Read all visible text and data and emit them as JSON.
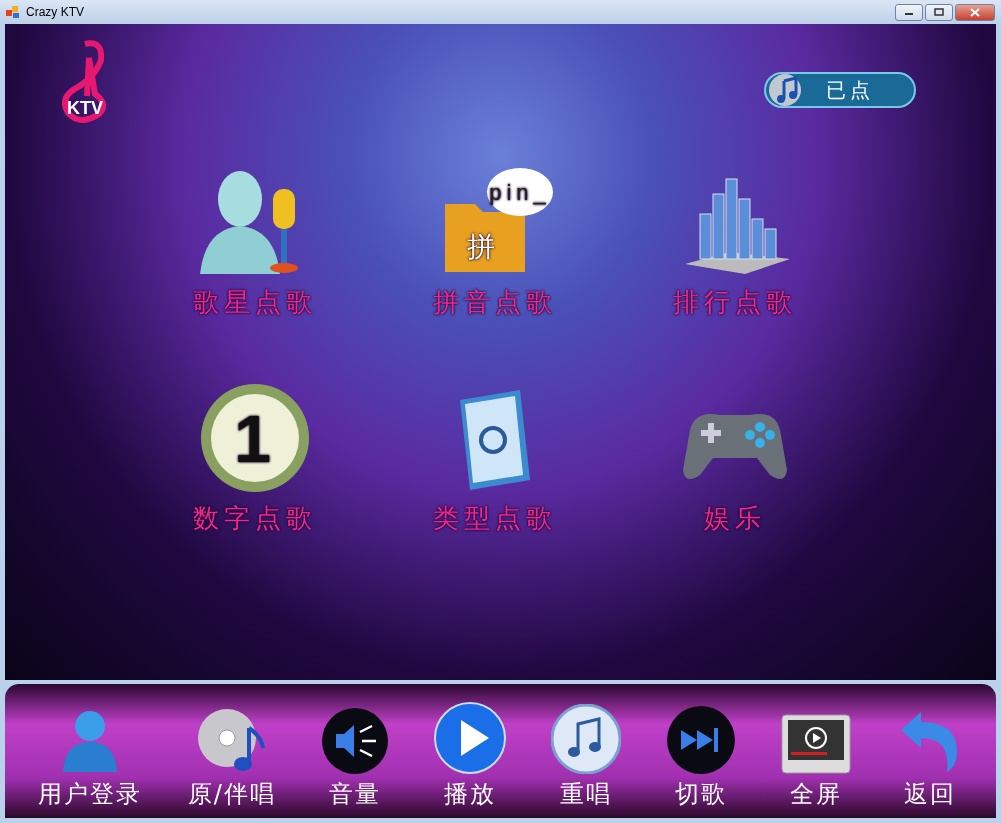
{
  "window": {
    "title": "Crazy KTV"
  },
  "logo": {
    "text": "KTV"
  },
  "queue_button": {
    "label": "已点"
  },
  "menu": [
    {
      "kind": "singer",
      "label": "歌星点歌"
    },
    {
      "kind": "pinyin",
      "label": "拼音点歌",
      "icon_text": "pin_",
      "badge": "拼"
    },
    {
      "kind": "chart",
      "label": "排行点歌"
    },
    {
      "kind": "number",
      "label": "数字点歌",
      "icon_text": "1"
    },
    {
      "kind": "genre",
      "label": "类型点歌"
    },
    {
      "kind": "game",
      "label": "娱乐"
    }
  ],
  "toolbar": [
    {
      "kind": "user",
      "label": "用户登录"
    },
    {
      "kind": "disc",
      "label": "原/伴唱"
    },
    {
      "kind": "volume",
      "label": "音量"
    },
    {
      "kind": "play",
      "label": "播放"
    },
    {
      "kind": "replay",
      "label": "重唱"
    },
    {
      "kind": "skip",
      "label": "切歌"
    },
    {
      "kind": "fullscreen",
      "label": "全屏"
    },
    {
      "kind": "back",
      "label": "返回"
    }
  ]
}
